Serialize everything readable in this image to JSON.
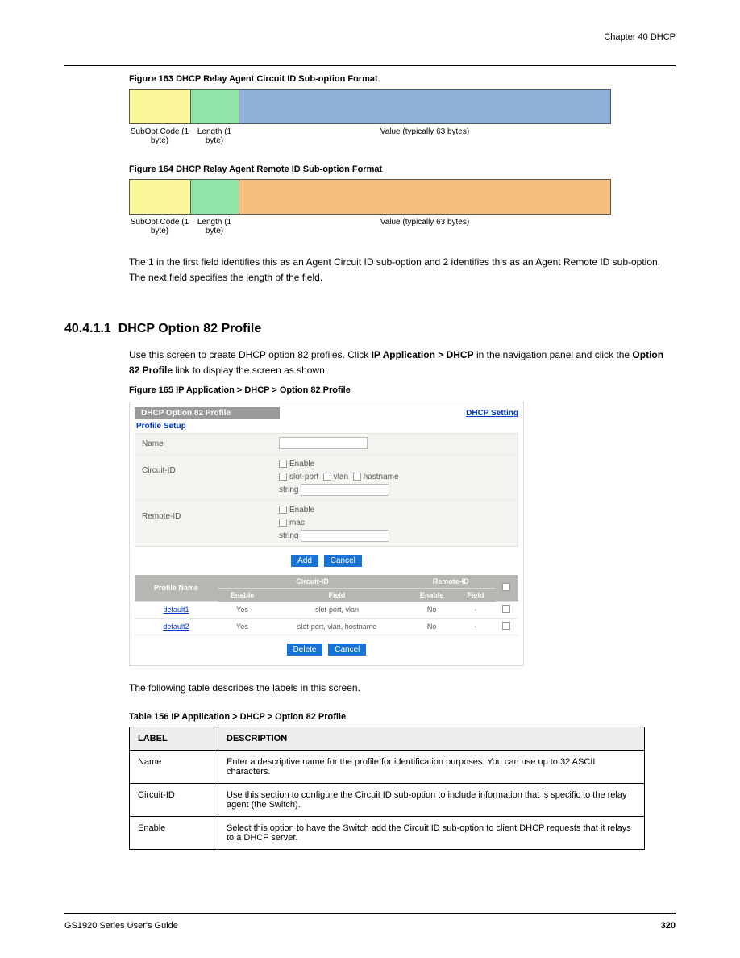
{
  "header": {
    "breadcrumb": "Chapter 40 DHCP"
  },
  "fig1": {
    "caption": "Figure 163   DHCP Relay Agent Circuit ID Sub-option Format",
    "labels": [
      "SubOpt Code (1 byte)",
      "Length (1 byte)",
      "Value (typically 63 bytes)"
    ]
  },
  "fig2": {
    "caption": "Figure 164   DHCP Relay Agent Remote ID Sub-option Format",
    "labels": [
      "SubOpt Code (1 byte)",
      "Length (1 byte)",
      "Value (typically 63 bytes)"
    ]
  },
  "para1": "The 1 in the first field identifies this as an Agent Circuit ID sub-option and 2 identifies this as an Agent Remote ID sub-option. The next field specifies the length of the field.",
  "section": {
    "number": "40.4.1.1",
    "title": "DHCP Option 82 Profile"
  },
  "para2_a": "Use this screen to create DHCP option 82 profiles. Click ",
  "para2_b": "IP Application > DHCP",
  "para2_c": " in the navigation panel and click the ",
  "para2_d": "Option 82 Profile",
  "para2_e": " link to display the screen as shown.",
  "ss_caption": "Figure 165   IP Application > DHCP > Option 82 Profile",
  "ss": {
    "banner": "DHCP Option 82 Profile",
    "link": "DHCP Setting",
    "subhead": "Profile Setup",
    "labels": {
      "name": "Name",
      "circuit": "Circuit-ID",
      "remote": "Remote-ID"
    },
    "opts": {
      "enable": "Enable",
      "slotport": "slot-port",
      "vlan": "vlan",
      "hostname": "hostname",
      "mac": "mac",
      "string": "string"
    },
    "btns": {
      "add": "Add",
      "cancel": "Cancel",
      "delete": "Delete"
    },
    "thead": {
      "profile": "Profile Name",
      "circuit": "Circuit-ID",
      "remote": "Remote-ID",
      "enable": "Enable",
      "field": "Field"
    },
    "rows": [
      {
        "name": "default1",
        "cen": "Yes",
        "cfield": "slot-port, vlan",
        "ren": "No",
        "rfield": "-"
      },
      {
        "name": "default2",
        "cen": "Yes",
        "cfield": "slot-port, vlan, hostname",
        "ren": "No",
        "rfield": "-"
      }
    ]
  },
  "doc_para": "The following table describes the labels in this screen.",
  "table_caption": "Table 156   IP Application > DHCP > Option 82 Profile",
  "table": {
    "head": [
      "LABEL",
      "DESCRIPTION"
    ],
    "rows": [
      [
        "Name",
        "Enter a descriptive name for the profile for identification purposes. You can use up to 32 ASCII characters."
      ],
      [
        "Circuit-ID",
        "Use this section to configure the Circuit ID sub-option to include information that is specific to the relay agent (the Switch)."
      ],
      [
        "Enable",
        "Select this option to have the Switch add the Circuit ID sub-option to client DHCP requests that it relays to a DHCP server."
      ]
    ]
  },
  "footer": {
    "left": "GS1920 Series User's Guide",
    "right": "320"
  }
}
